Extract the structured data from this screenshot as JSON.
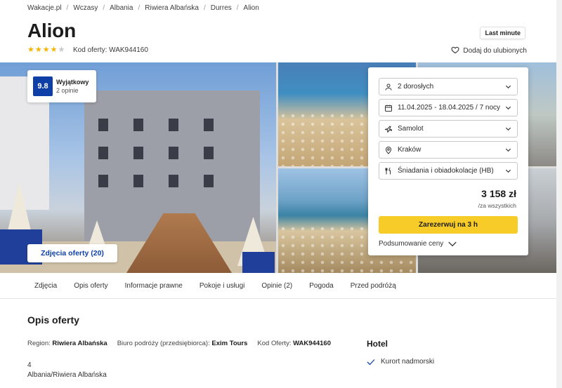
{
  "breadcrumb": [
    "Wakacje.pl",
    "Wczasy",
    "Albania",
    "Riwiera Albańska",
    "Durres",
    "Alion"
  ],
  "hotel": {
    "name": "Alion",
    "stars": 4,
    "stars_max": 5,
    "offer_code_text": "Kod oferty: WAK944160",
    "badge": "Last minute",
    "favorite_label": "Dodaj do ulubionych"
  },
  "rating": {
    "score": "9.8",
    "label": "Wyjątkowy",
    "count": "2 opinie"
  },
  "gallery": {
    "photos_button": "Zdjęcia oferty (20)"
  },
  "booking": {
    "guests": "2 dorosłych",
    "dates": "11.04.2025 - 18.04.2025 / 7 nocy",
    "transport": "Samolot",
    "departure": "Kraków",
    "board": "Śniadania i obiadokolacje (HB)",
    "price": "3 158 zł",
    "price_note": "/za wszystkich",
    "book_button": "Zarezerwuj na 3 h",
    "summary_link": "Podsumowanie ceny"
  },
  "tabs": [
    "Zdjęcia",
    "Opis oferty",
    "Informacje prawne",
    "Pokoje i usługi",
    "Opinie (2)",
    "Pogoda",
    "Przed podróżą"
  ],
  "description": {
    "title": "Opis oferty",
    "region_label": "Region:",
    "region_value": "Riwiera Albańska",
    "agency_label": "Biuro podróży (przedsiębiorca):",
    "agency_value": "Exim Tours",
    "code_label": "Kod Oferty:",
    "code_value": "WAK944160",
    "stars_number": "4",
    "location": "Albania/Riwiera Albańska"
  },
  "hotel_features": {
    "title": "Hotel",
    "items": [
      "Kurort nadmorski"
    ]
  },
  "colors": {
    "brand_blue": "#0d3fa6",
    "accent_yellow": "#f8cc28",
    "star": "#f5b301"
  }
}
